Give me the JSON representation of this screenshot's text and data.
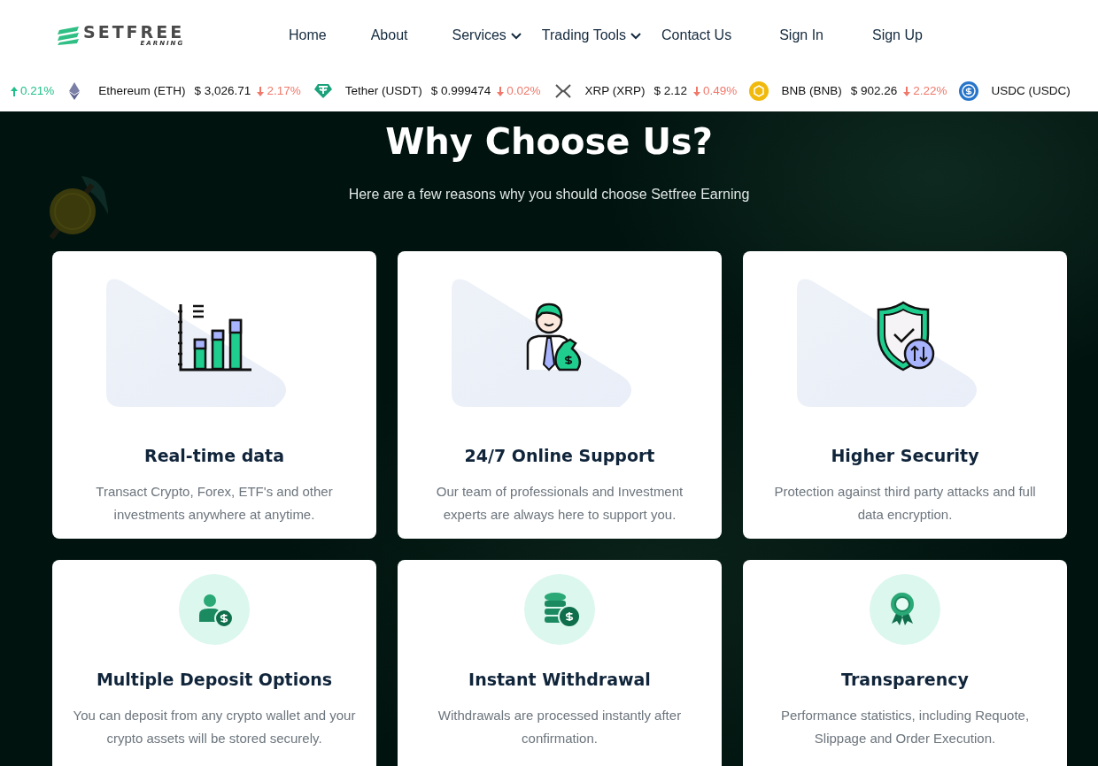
{
  "logo": {
    "name": "SETFREE",
    "tagline": "EARNING"
  },
  "nav": [
    {
      "label": "Home",
      "dropdown": false
    },
    {
      "label": "About",
      "dropdown": false
    },
    {
      "label": "Services",
      "dropdown": true
    },
    {
      "label": "Trading Tools",
      "dropdown": true
    },
    {
      "label": "Contact Us",
      "dropdown": false
    },
    {
      "label": "Sign In",
      "dropdown": false
    },
    {
      "label": "Sign Up",
      "dropdown": false
    }
  ],
  "ticker": [
    {
      "kind": "change_only",
      "change": "0.21%",
      "rising": true
    },
    {
      "kind": "coin",
      "name": "Ethereum (ETH)",
      "price": "$ 3,026.71",
      "change": "2.17%",
      "rising": false
    },
    {
      "kind": "coin",
      "name": "Tether (USDT)",
      "price": "$ 0.999474",
      "change": "0.02%",
      "rising": false
    },
    {
      "kind": "coin",
      "name": "XRP (XRP)",
      "price": "$ 2.12",
      "change": "0.49%",
      "rising": false
    },
    {
      "kind": "coin",
      "name": "BNB (BNB)",
      "price": "$ 902.26",
      "change": "2.22%",
      "rising": false
    },
    {
      "kind": "coin",
      "name": "USDC (USDC)"
    }
  ],
  "section": {
    "title": "Why Choose Us?",
    "subtitle": "Here are a few reasons why you should choose Setfree Earning"
  },
  "cards": [
    {
      "kind": "illustration",
      "title": "Real-time data",
      "text": "Transact Crypto, Forex, ETF's and other investments anywhere at anytime."
    },
    {
      "kind": "illustration",
      "title": "24/7 Online Support",
      "text": "Our team of professionals and Investment experts are always here to support you."
    },
    {
      "kind": "illustration",
      "title": "Higher Security",
      "text": "Protection against third party attacks and full data encryption."
    },
    {
      "kind": "circle",
      "title": "Multiple Deposit Options",
      "text": "You can deposit from any crypto wallet and your crypto assets will be stored securely."
    },
    {
      "kind": "circle",
      "title": "Instant Withdrawal",
      "text": "Withdrawals are processed instantly after confirmation."
    },
    {
      "kind": "circle",
      "title": "Transparency",
      "text": "Performance statistics, including Requote, Slippage and Order Execution."
    }
  ]
}
